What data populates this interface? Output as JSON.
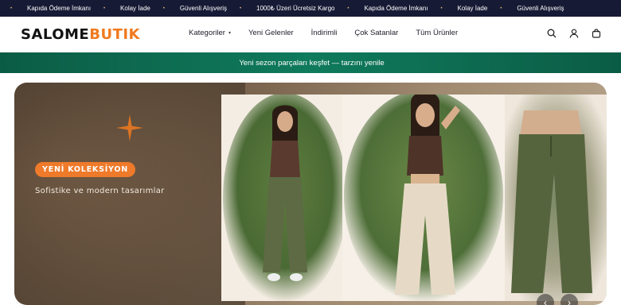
{
  "ticker": {
    "items": [
      {
        "icon": "truck-icon",
        "text": "Kapıda Ödeme İmkanı"
      },
      {
        "icon": "return-icon",
        "text": "Kolay İade"
      },
      {
        "icon": "shield-icon",
        "text": "Güvenli Alışveriş"
      },
      {
        "icon": "gift-icon",
        "text": "1000₺ Üzeri Ücretsiz Kargo"
      },
      {
        "icon": "truck-icon",
        "text": "Kapıda Ödeme İmkanı"
      },
      {
        "icon": "return-icon",
        "text": "Kolay İade"
      },
      {
        "icon": "shield-icon",
        "text": "Güvenli Alışveriş"
      }
    ],
    "leading_glyph": "",
    "separator": "•",
    "icon_glyph": ""
  },
  "header": {
    "logo_part1": "SALOME",
    "logo_part2": "BUTIK",
    "nav": [
      {
        "label": "Kategoriler",
        "has_dropdown": true
      },
      {
        "label": "Yeni Gelenler",
        "has_dropdown": false
      },
      {
        "label": "İndirimli",
        "has_dropdown": false
      },
      {
        "label": "Çok Satanlar",
        "has_dropdown": false
      },
      {
        "label": "Tüm Ürünler",
        "has_dropdown": false
      }
    ],
    "icons": [
      "search-icon",
      "user-icon",
      "cart-icon"
    ]
  },
  "promo": {
    "icon_glyph": "",
    "text": "Yeni sezon parçaları keşfet — tarzını yenile"
  },
  "hero": {
    "badge": "YENİ KOLEKSİYON",
    "subtitle": "Sofistike ve modern tasarımlar",
    "prev_label": "‹",
    "next_label": "›"
  },
  "colors": {
    "ticker_bg": "#171a35",
    "brand_orange": "#f07a1e",
    "promo_green": "#0b5c45",
    "badge_orange": "#ee7a2a"
  }
}
